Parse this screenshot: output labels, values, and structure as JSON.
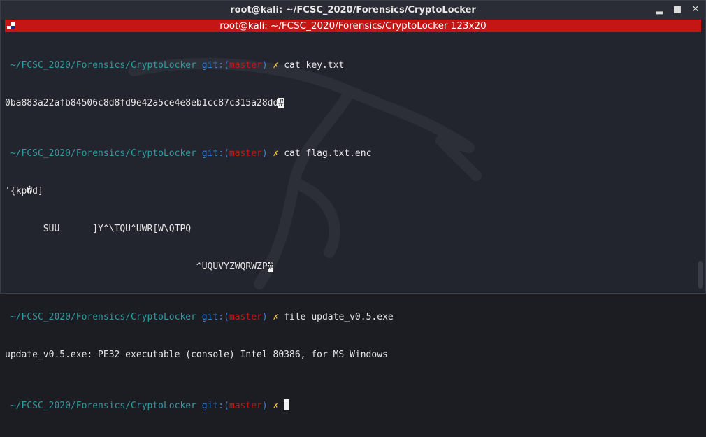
{
  "window": {
    "title": "root@kali: ~/FCSC_2020/Forensics/CryptoLocker",
    "controls": {
      "minimize": "▂",
      "maximize": "■",
      "close": "✕"
    }
  },
  "tab": {
    "title": "root@kali: ~/FCSC_2020/Forensics/CryptoLocker 123x20"
  },
  "prompt": {
    "path": " ~/FCSC_2020/Forensics/CryptoLocker",
    "git": " git:(",
    "branch": "master",
    "git_close": ")",
    "symbol": " ✗ "
  },
  "terminal": {
    "cmd1": "cat key.txt",
    "out1": "0ba883a22afb84506c8d8fd9e42a5ce4e8eb1cc87c315a28dd",
    "out1_end": "#",
    "cmd2": "cat flag.txt.enc",
    "out2_a": "'{kp�d]",
    "out2_b": "       SUU      ]Y^\\TQU^UWR[W\\QTPQ",
    "out2_c": "                                   ^UQUVYZWQRWZP",
    "out2_end": "#",
    "cmd3": "file update_v0.5.exe",
    "out3": "update_v0.5.exe: PE32 executable (console) Intel 80386, for MS Windows"
  },
  "colors": {
    "background": "#23252e",
    "tab_red": "#c51616",
    "path": "#2f9aa0",
    "git": "#3f7fd0",
    "branch": "#c51616",
    "prompt_symbol": "#e8c531"
  }
}
